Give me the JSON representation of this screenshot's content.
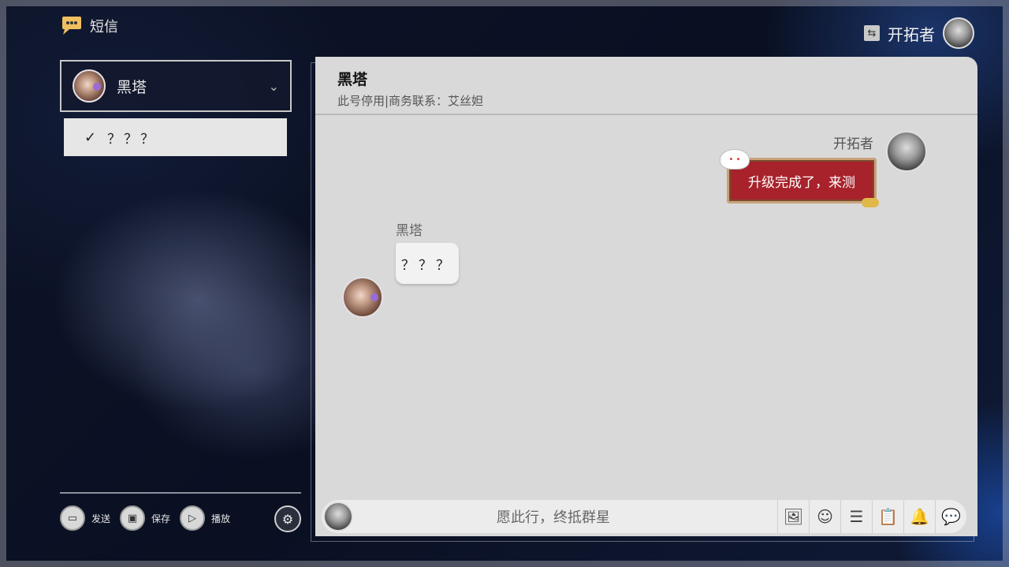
{
  "app": {
    "title": "短信"
  },
  "user": {
    "name": "开拓者"
  },
  "contact_selector": {
    "selected": "黑塔",
    "options": [
      "？？？"
    ]
  },
  "controls": {
    "send": "发送",
    "save": "保存",
    "play": "播放"
  },
  "chat": {
    "contact_name": "黑塔",
    "contact_status": "此号停用|商务联系：艾丝妲",
    "messages": [
      {
        "sender": "开拓者",
        "text": "升级完成了，来测",
        "side": "right",
        "kind": "sticker"
      },
      {
        "sender": "黑塔",
        "text": "？？？",
        "side": "left",
        "kind": "bubble"
      }
    ],
    "input_placeholder": "愿此行，终抵群星"
  },
  "icons": [
    "chat-icon",
    "switch-icon",
    "chevron-down-icon",
    "check-icon",
    "send-icon",
    "image-icon",
    "play-icon",
    "settings-icon",
    "add-image-icon",
    "emoji-icon",
    "menu-icon",
    "clipboard-icon",
    "bell-icon",
    "message-icon"
  ]
}
